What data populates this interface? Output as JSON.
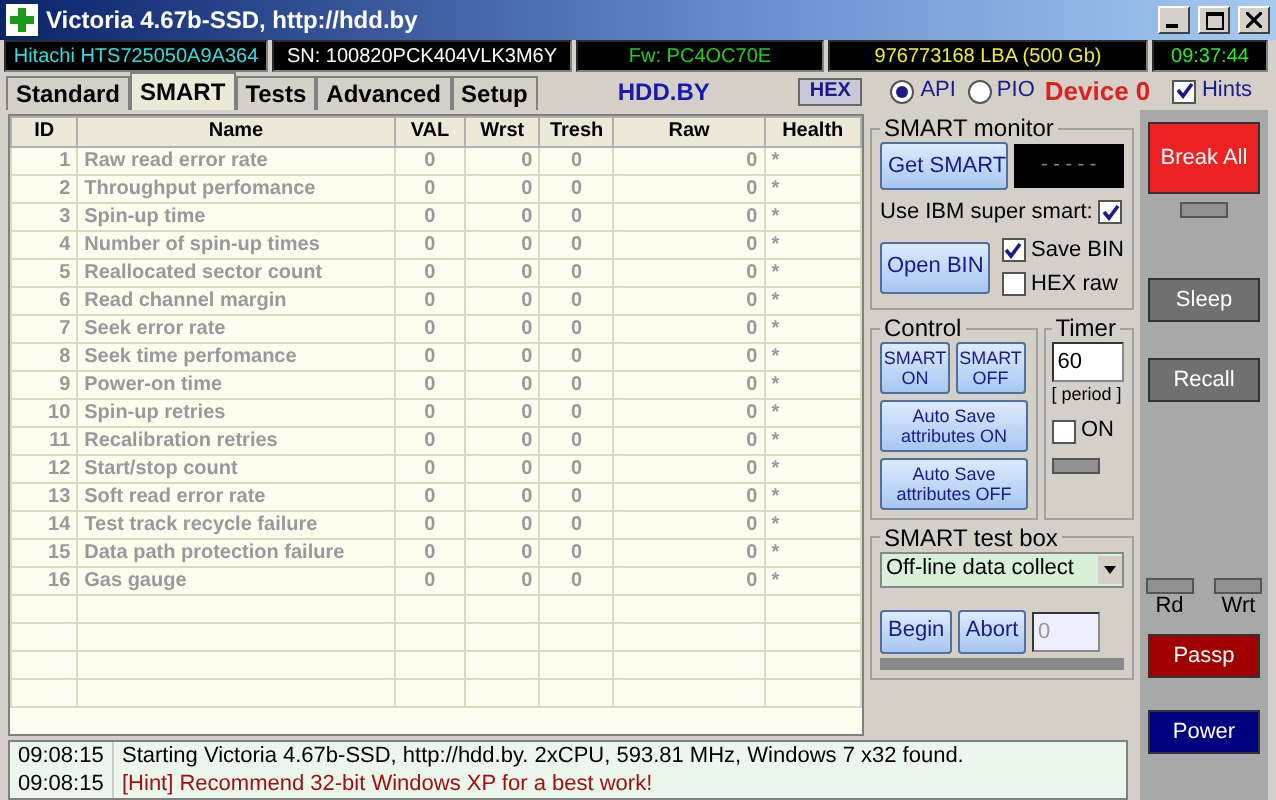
{
  "window": {
    "title": "Victoria 4.67b-SSD, http://hdd.by"
  },
  "info_bar": [
    {
      "text": "Hitachi HTS725050A9A364",
      "color": "#33dddd"
    },
    {
      "text": "SN: 100820PCK404VLK3M6Y",
      "color": "#ffffff"
    },
    {
      "text": "Fw: PC4OC70E",
      "color": "#22cc22"
    },
    {
      "text": "976773168 LBA (500 Gb)",
      "color": "#eeee33"
    },
    {
      "text": "09:37:44",
      "color": "#22ee22"
    }
  ],
  "tabs": [
    {
      "label": "Standard",
      "selected": false
    },
    {
      "label": "SMART",
      "selected": true
    },
    {
      "label": "Tests",
      "selected": false
    },
    {
      "label": "Advanced",
      "selected": false
    },
    {
      "label": "Setup",
      "selected": false
    }
  ],
  "brand": "HDD.BY",
  "hex_button": "HEX",
  "interface": [
    {
      "label": "API",
      "selected": true
    },
    {
      "label": "PIO",
      "selected": false
    }
  ],
  "device": "Device 0",
  "hints": {
    "label": "Hints",
    "checked": true
  },
  "table": {
    "columns": [
      "ID",
      "Name",
      "VAL",
      "Wrst",
      "Tresh",
      "Raw",
      "Health"
    ],
    "rows": [
      [
        "1",
        "Raw read error rate",
        "0",
        "0",
        "0",
        "0",
        "*"
      ],
      [
        "2",
        "Throughput perfomance",
        "0",
        "0",
        "0",
        "0",
        "*"
      ],
      [
        "3",
        "Spin-up time",
        "0",
        "0",
        "0",
        "0",
        "*"
      ],
      [
        "4",
        "Number of spin-up times",
        "0",
        "0",
        "0",
        "0",
        "*"
      ],
      [
        "5",
        "Reallocated sector count",
        "0",
        "0",
        "0",
        "0",
        "*"
      ],
      [
        "6",
        "Read channel margin",
        "0",
        "0",
        "0",
        "0",
        "*"
      ],
      [
        "7",
        "Seek error rate",
        "0",
        "0",
        "0",
        "0",
        "*"
      ],
      [
        "8",
        "Seek time perfomance",
        "0",
        "0",
        "0",
        "0",
        "*"
      ],
      [
        "9",
        "Power-on time",
        "0",
        "0",
        "0",
        "0",
        "*"
      ],
      [
        "10",
        "Spin-up retries",
        "0",
        "0",
        "0",
        "0",
        "*"
      ],
      [
        "11",
        "Recalibration retries",
        "0",
        "0",
        "0",
        "0",
        "*"
      ],
      [
        "12",
        "Start/stop count",
        "0",
        "0",
        "0",
        "0",
        "*"
      ],
      [
        "13",
        "Soft read error rate",
        "0",
        "0",
        "0",
        "0",
        "*"
      ],
      [
        "14",
        "Test track recycle failure",
        "0",
        "0",
        "0",
        "0",
        "*"
      ],
      [
        "15",
        "Data path protection failure",
        "0",
        "0",
        "0",
        "0",
        "*"
      ],
      [
        "16",
        "Gas gauge",
        "0",
        "0",
        "0",
        "0",
        "*"
      ]
    ]
  },
  "smart_monitor": {
    "title": "SMART monitor",
    "get_button": "Get SMART",
    "display": "- - - - -",
    "ibm": {
      "label": "Use IBM super smart:",
      "checked": true
    },
    "open_button": "Open BIN",
    "options": [
      {
        "label": "Save BIN",
        "checked": true
      },
      {
        "label": "HEX raw",
        "checked": false
      }
    ]
  },
  "control": {
    "title": "Control",
    "buttons": [
      "SMART ON",
      "SMART OFF",
      "Auto Save attributes ON",
      "Auto Save attributes OFF"
    ]
  },
  "timer": {
    "title": "Timer",
    "value": "60",
    "caption": "[ period ]",
    "on": {
      "label": "ON",
      "checked": false
    }
  },
  "test_box": {
    "title": "SMART test box",
    "selected": "Off-line data collect",
    "begin": "Begin",
    "abort": "Abort",
    "count": "0"
  },
  "side": {
    "break_all": "Break All",
    "sleep": "Sleep",
    "recall": "Recall",
    "read": "Rd",
    "write": "Wrt",
    "passp": "Passp",
    "power": "Power"
  },
  "log": [
    {
      "time": "09:08:15",
      "text": "Starting Victoria 4.67b-SSD, http://hdd.by. 2xCPU, 593.81 MHz, Windows 7 x32 found.",
      "kind": "info"
    },
    {
      "time": "09:08:15",
      "text": "[Hint] Recommend 32-bit Windows XP for a best work!",
      "kind": "hint"
    }
  ]
}
